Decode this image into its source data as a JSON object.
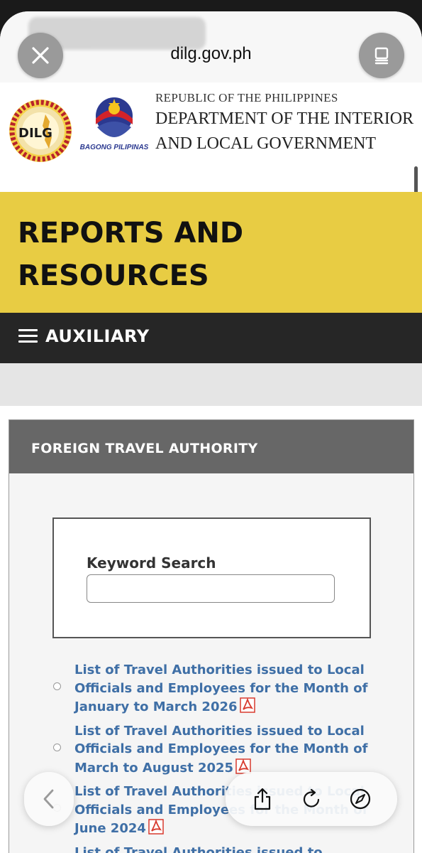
{
  "browser": {
    "url": "dilg.gov.ph"
  },
  "header": {
    "republic": "REPUBLIC OF THE PHILIPPINES",
    "dept_line1": "DEPARTMENT OF THE INTERIOR",
    "dept_line2": "AND LOCAL GOVERNMENT",
    "seal_text": "DILG",
    "bagong_pilipinas": "BAGONG PILIPINAS"
  },
  "page": {
    "title": "REPORTS AND RESOURCES",
    "nav_label": "AUXILIARY"
  },
  "panel": {
    "title": "FOREIGN TRAVEL AUTHORITY",
    "search_label": "Keyword Search",
    "search_value": ""
  },
  "documents": [
    {
      "title": "List of Travel Authorities issued to Local Officials and Employees for the Month of January to March 2026"
    },
    {
      "title": "List of Travel Authorities issued to Local Officials and Employees for the Month of March to August 2025"
    },
    {
      "title": "List of Travel Authorities issued to Local Officials and Employees for the Month of June 2024"
    },
    {
      "title": "List of Travel Authorities issued to"
    }
  ],
  "colors": {
    "banner": "#e8cc43",
    "nav_bar": "#262626",
    "panel_header": "#676767",
    "link": "#3f6fa6",
    "pdf_red": "#d83a2e"
  },
  "icons": {
    "close": "close-icon",
    "tabs": "tabs-icon",
    "back": "chevron-left-icon",
    "share": "share-icon",
    "reload": "reload-icon",
    "safari": "compass-icon",
    "pdf": "pdf-icon"
  }
}
